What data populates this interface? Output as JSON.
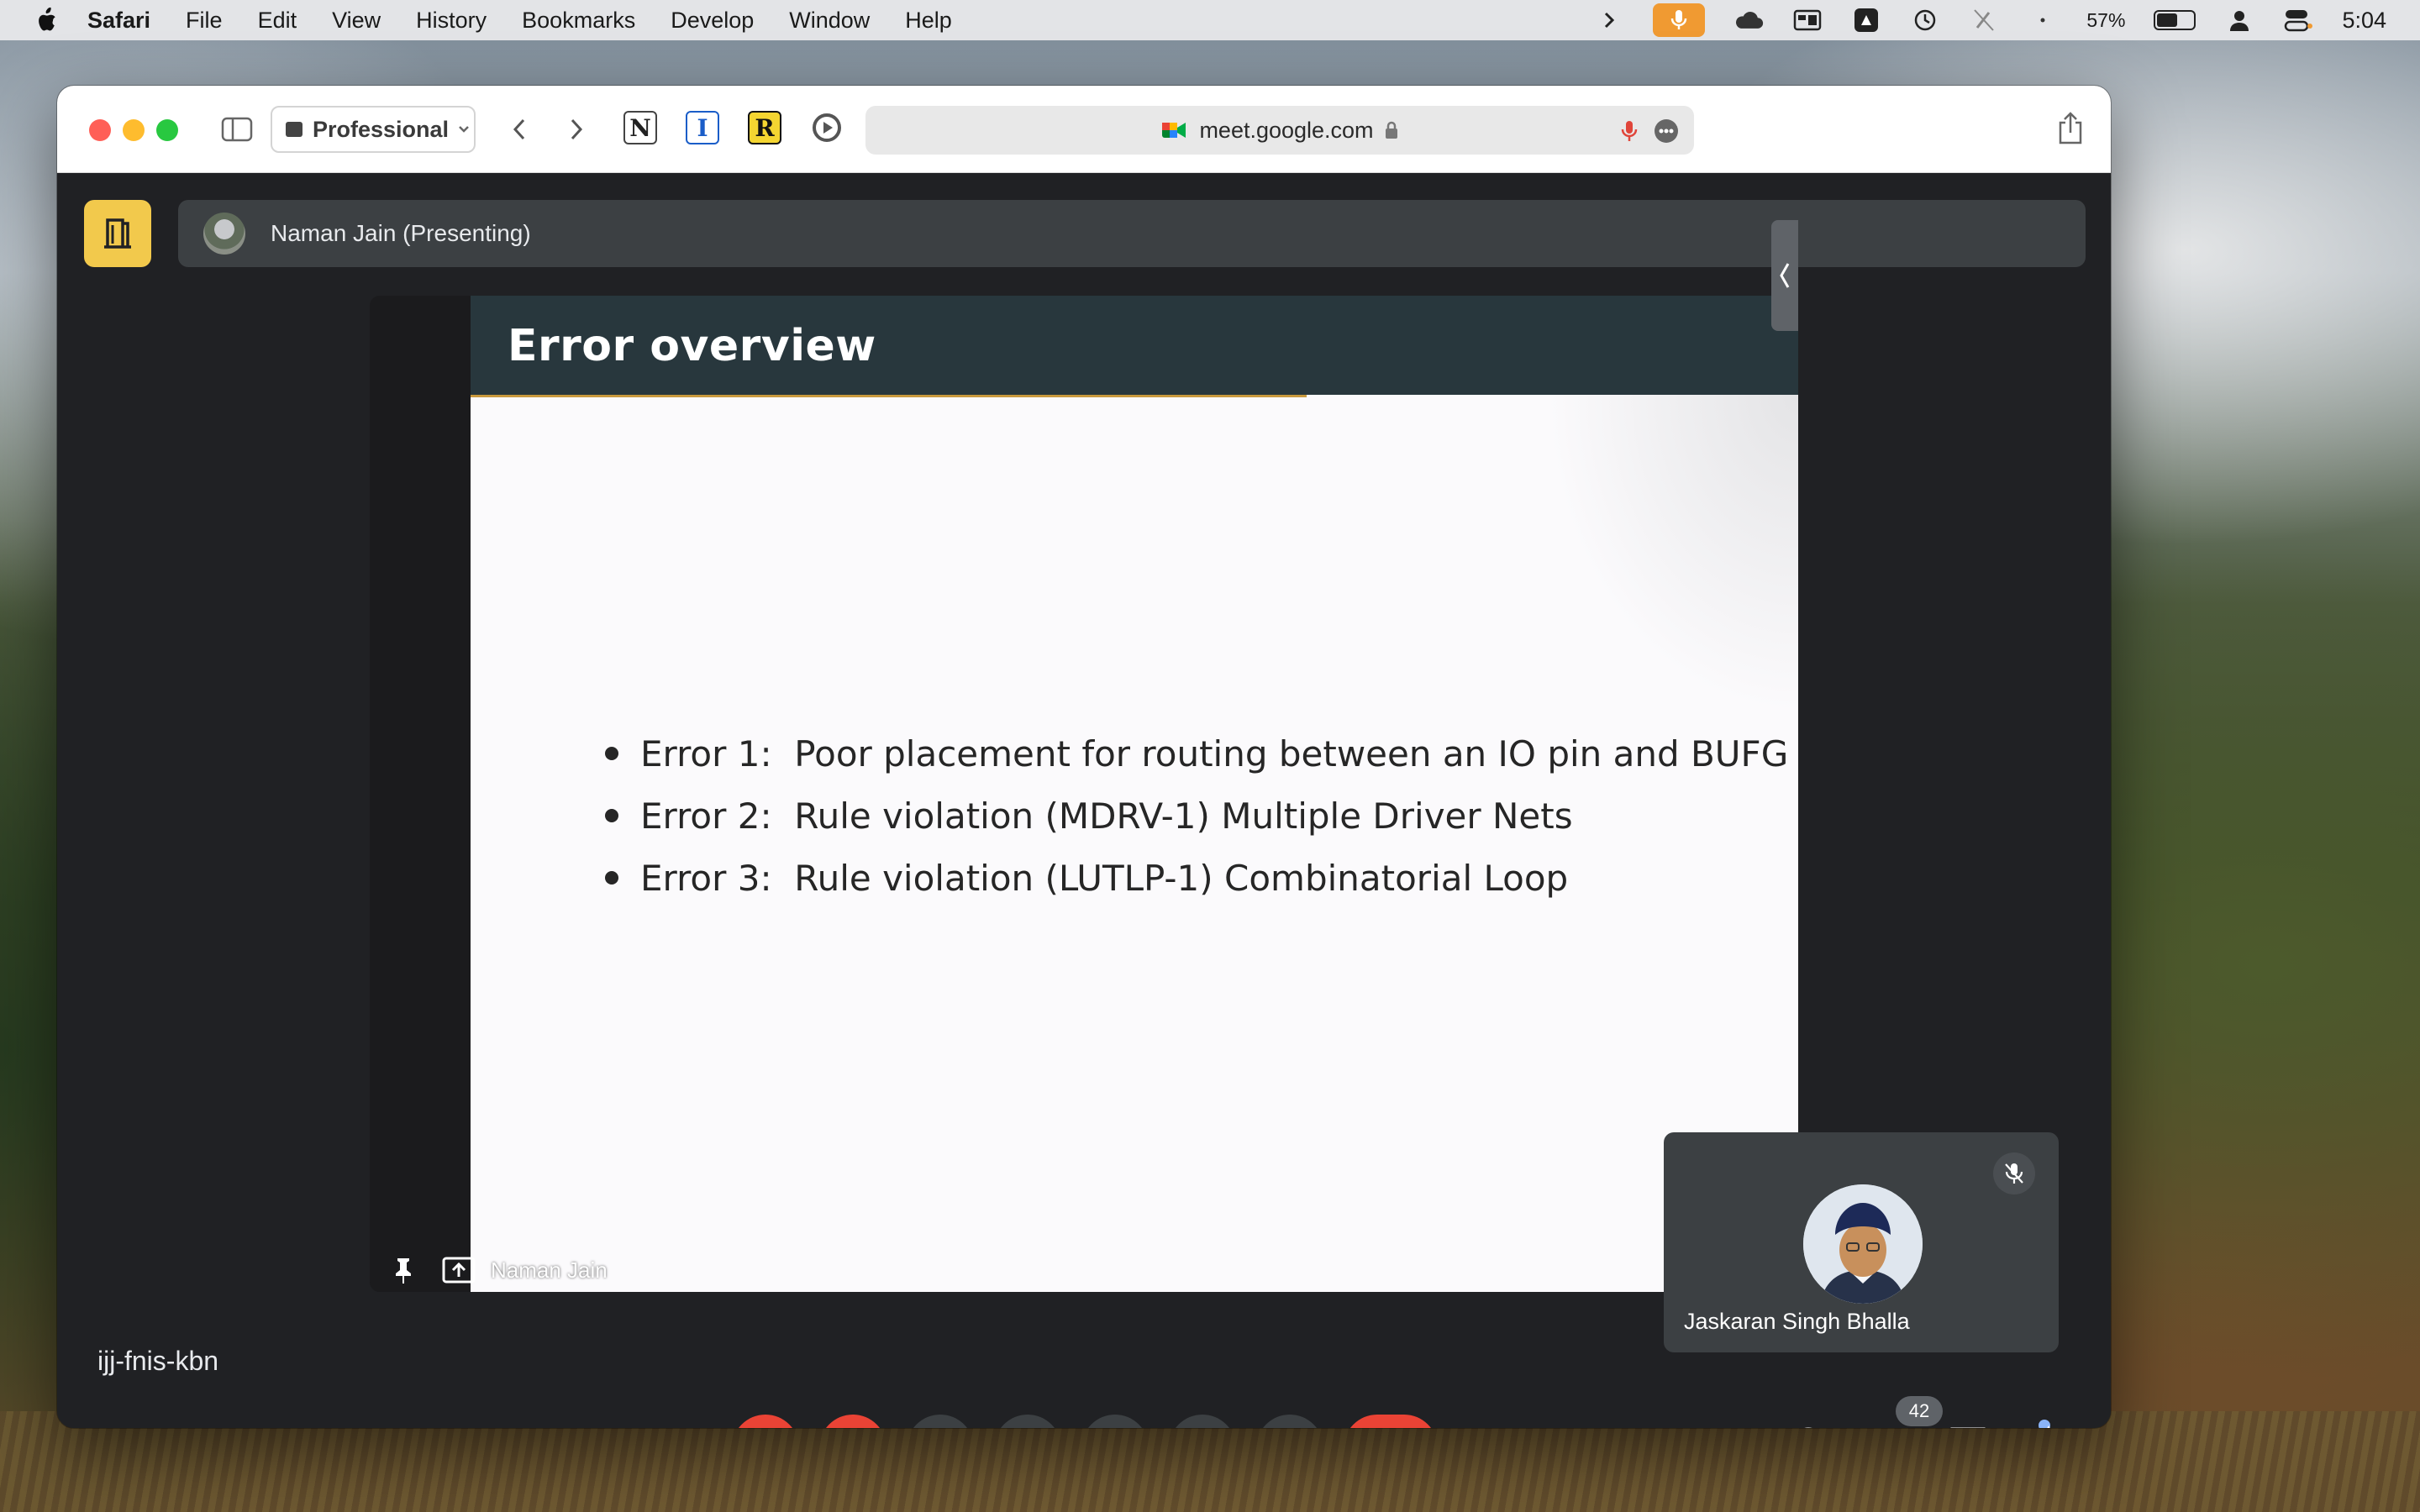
{
  "menubar": {
    "app": "Safari",
    "items": [
      "File",
      "Edit",
      "View",
      "History",
      "Bookmarks",
      "Develop",
      "Window",
      "Help"
    ],
    "battery_percent": "57%",
    "battery_level": 0.57,
    "time": "5:04"
  },
  "browser": {
    "profile": "Professional",
    "url": "meet.google.com",
    "extensions": [
      "notion-icon",
      "instapaper-icon",
      "readwise-icon",
      "screen-recorder-icon"
    ]
  },
  "meet": {
    "presenter": "Naman Jain (Presenting)",
    "slide": {
      "title": "Error overview",
      "bullets": [
        "Error 1:  Poor placement for routing between an IO pin and BUFG",
        "Error 2:  Rule violation (MDRV-1) Multiple Driver Nets",
        "Error 3:  Rule violation (LUTLP-1) Combinatorial Loop"
      ]
    },
    "stage_name": "Naman Jain",
    "self_tile_name": "Jaskaran Singh Bhalla",
    "meeting_code": "ijj-fnis-kbn",
    "participants_count": "42",
    "colors": {
      "accent_yellow": "#f2c94c",
      "end_red": "#ea4335",
      "slide_header": "#28373d",
      "slide_rule": "#c99a3e"
    }
  }
}
